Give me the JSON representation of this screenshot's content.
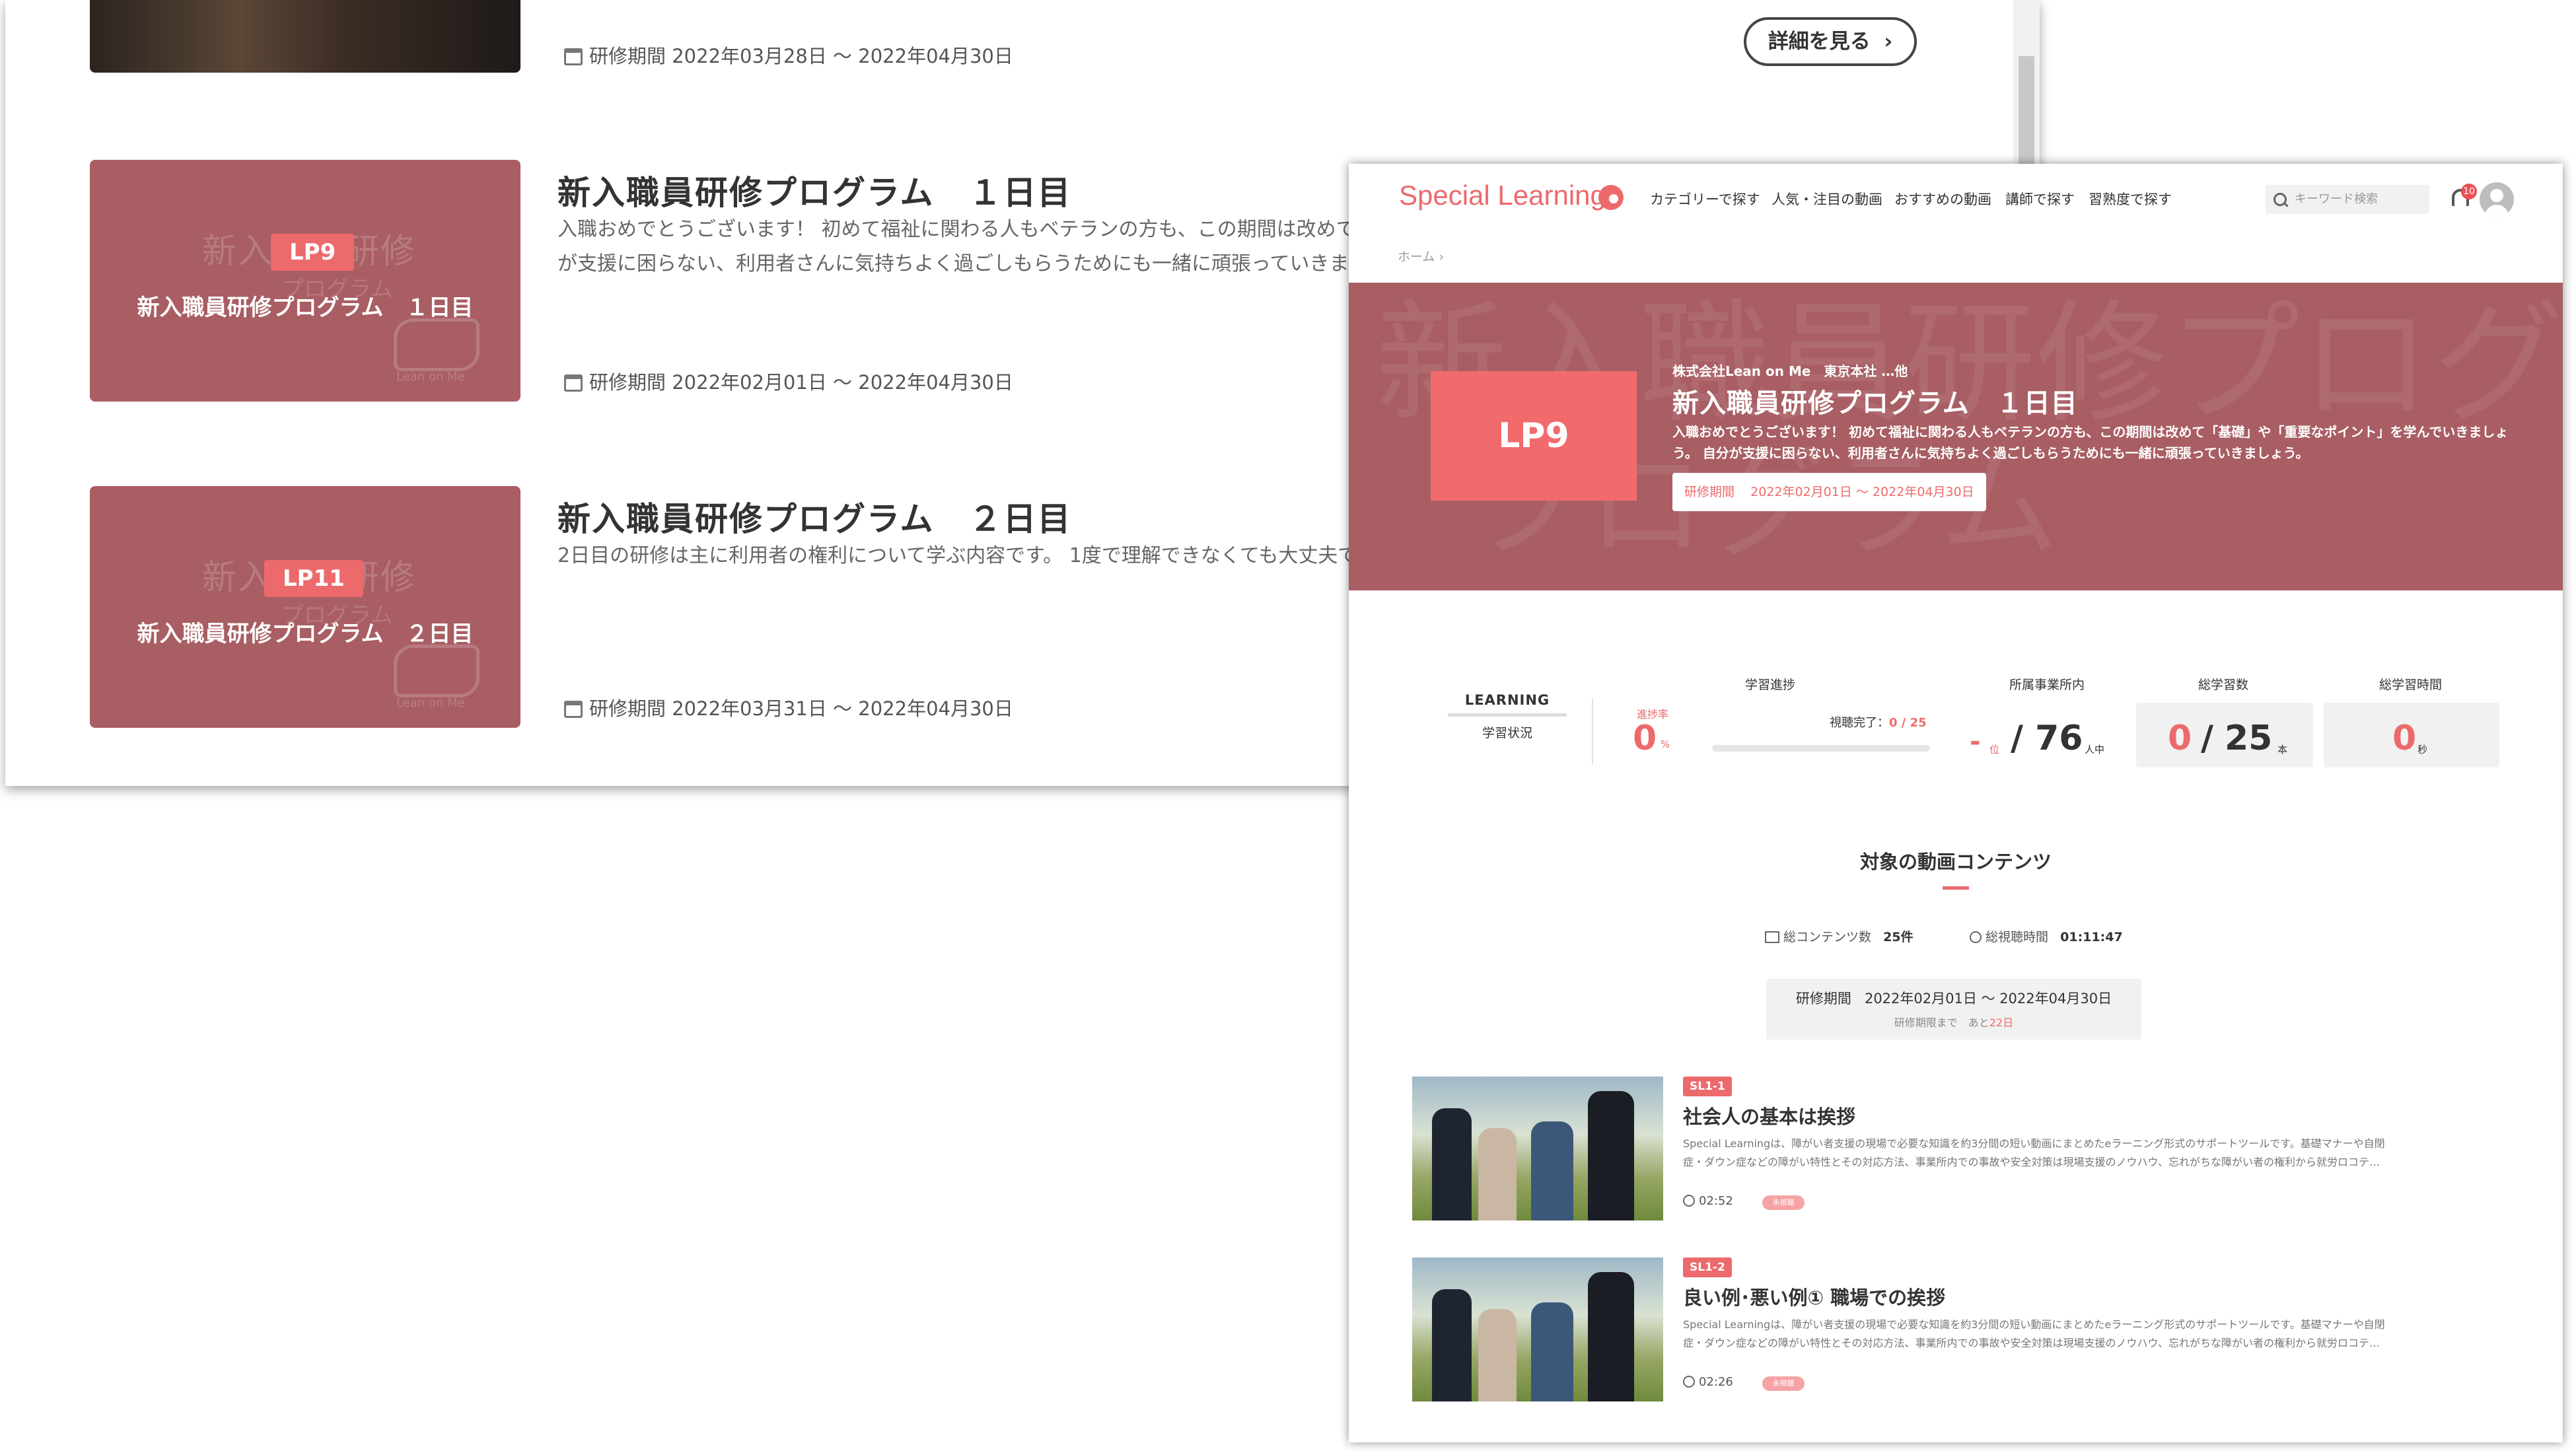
{
  "back_page": {
    "top_item": {
      "period": "研修期間 2022年03月28日 〜 2022年04月30日",
      "detail_label": "詳細を見る"
    },
    "programs": [
      {
        "badge": "LP9",
        "thumb_title": "新入職員研修プログラム　１日目",
        "ghost_text": "新入職員研修",
        "ghost_sub": "プログラム",
        "logo_text": "Lean on Me",
        "title": "新入職員研修プログラム　１日目",
        "desc_line1": "入職おめでとうございます！ 初めて福祉に関わる人もベテランの方も、この期間は改めて",
        "desc_line2": "が支援に困らない、利用者さんに気持ちよく過ごしもらうためにも一緒に頑張っていきま",
        "period": "研修期間 2022年02月01日 〜 2022年04月30日"
      },
      {
        "badge": "LP11",
        "thumb_title": "新入職員研修プログラム　２日目",
        "ghost_text": "新入職員研修",
        "ghost_sub": "プログラム",
        "logo_text": "Lean on Me",
        "title": "新入職員研修プログラム　２日目",
        "desc_line1": "2日目の研修は主に利用者の権利について学ぶ内容です。 1度で理解できなくても大丈夫で",
        "desc_line2": "",
        "period": "研修期間 2022年03月31日 〜 2022年04月30日"
      }
    ]
  },
  "front_page": {
    "header": {
      "logo": "Special Learning",
      "nav": [
        "カテゴリーで探す",
        "人気・注目の動画",
        "おすすめの動画",
        "講師で探す",
        "習熟度で探す"
      ],
      "search_placeholder": "キーワード検索",
      "notification_count": "10"
    },
    "breadcrumb": "ホーム ›",
    "hero": {
      "badge": "LP9",
      "org": "株式会社Lean on Me　東京本社 …他",
      "title": "新入職員研修プログラム　１日目",
      "desc_line1": "入職おめでとうございます！ 初めて福祉に関わる人もベテランの方も、この期間は改めて「基礎」や「重要なポイント」を学んでいきましょ",
      "desc_line2": "う。 自分が支援に困らない、利用者さんに気持ちよく過ごしもらうためにも一緒に頑張っていきましょう。",
      "period_label": "研修期間",
      "period_value": "2022年02月01日 〜 2022年04月30日",
      "ghost_text": "新入職員研修プログラム",
      "ghost_text2": "プログラム"
    },
    "stats": {
      "learning_en": "LEARNING",
      "learning_ja": "学習状況",
      "progress_label": "学習進捗",
      "rate_label": "進捗率",
      "rate_value": "0",
      "rate_unit": "%",
      "progress_fraction": 0,
      "watched_label": "視聴完了：",
      "watched_value": "0 / 25",
      "dept_label": "所属事業所内",
      "dept_rank": "-",
      "dept_rank_unit": "位",
      "dept_total": "/ 76",
      "dept_total_unit": "人中",
      "total_count_label": "総学習数",
      "total_count_value": "0",
      "total_count_sep": "/",
      "total_count_max": "25",
      "total_count_unit": "本",
      "total_time_label": "総学習時間",
      "total_time_value": "0",
      "total_time_unit": "秒"
    },
    "section": {
      "title": "対象の動画コンテンツ",
      "content_count_label": "総コンテンツ数",
      "content_count": "25件",
      "watch_time_label": "総視聴時間",
      "watch_time": "01:11:47",
      "period_label": "研修期間",
      "period_value": "2022年02月01日 〜 2022年04月30日",
      "remaining_label": "研修期限まで　あと",
      "remaining_value": "22日"
    },
    "videos": [
      {
        "tag": "SL1-1",
        "title": "社会人の基本は挨拶",
        "desc_line1": "Special Learningは、障がい者支援の現場で必要な知識を約3分間の短い動画にまとめたeラーニング形式のサポートツールです。基礎マナーや自閉",
        "desc_line2": "症・ダウン症などの障がい特性とその対応方法、事業所内での事故や安全対策は現場支援のノウハウ、忘れがちな障がい者の権利から就労ロコテ…",
        "duration": "02:52",
        "pill": "未視聴"
      },
      {
        "tag": "SL1-2",
        "title": "良い例･悪い例① 職場での挨拶",
        "desc_line1": "Special Learningは、障がい者支援の現場で必要な知識を約3分間の短い動画にまとめたeラーニング形式のサポートツールです。基礎マナーや自閉",
        "desc_line2": "症・ダウン症などの障がい特性とその対応方法、事業所内での事故や安全対策は現場支援のノウハウ、忘れがちな障がい者の権利から就労ロコテ…",
        "duration": "02:26",
        "pill": "未視聴"
      }
    ]
  },
  "colors": {
    "accent": "#ec6a6c",
    "hero_bg": "#a85e63"
  }
}
